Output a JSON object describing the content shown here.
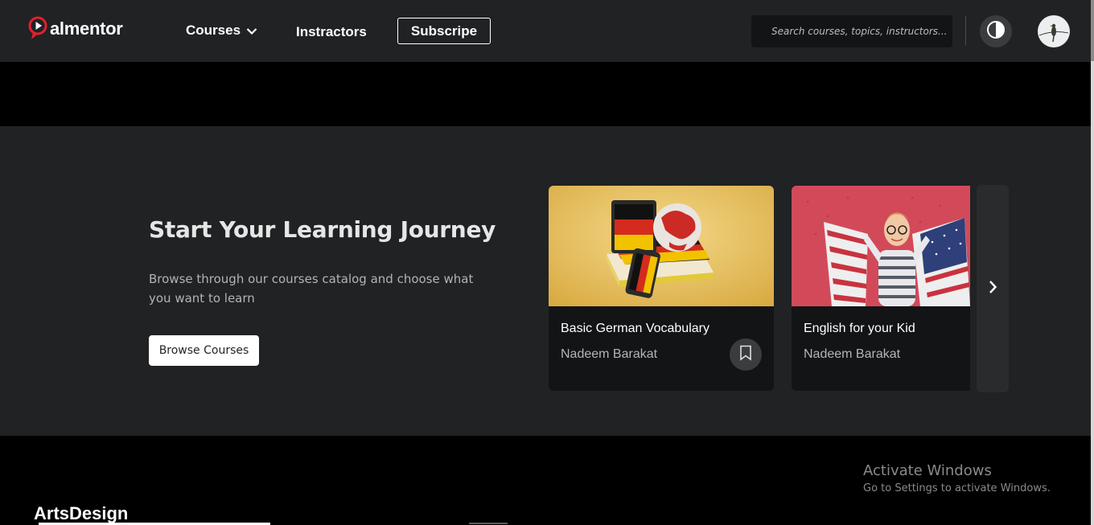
{
  "header": {
    "logo_text": "almentor",
    "nav": {
      "courses_label": "Courses",
      "instructors_label": "Instractors",
      "subscribe_label": "Subscripe"
    },
    "search": {
      "placeholder": "Search courses, topics, instructors..."
    },
    "icons": [
      "play-logo-icon",
      "chevron-down-icon",
      "contrast-icon",
      "avatar-bird-icon"
    ]
  },
  "hero": {
    "title": "Start Your Learning Journey",
    "description": "Browse through our courses catalog and choose what you want to learn",
    "button_label": "Browse Courses",
    "cards": [
      {
        "title": "Basic German Vocabulary",
        "author": "Nadeem Barakat",
        "image": "german-flag-books-globe-image",
        "bookmark_icon": "bookmark-icon"
      },
      {
        "title": "English for your Kid",
        "author": "Nadeem Barakat",
        "image": "boy-with-us-flag-image"
      }
    ],
    "next_icon": "chevron-right-icon"
  },
  "footer": {
    "brand": "ArtsDesign"
  },
  "watermark": {
    "title": "Activate Windows",
    "subtitle": "Go to Settings to activate Windows."
  },
  "colors": {
    "header_bg": "#202224",
    "page_bg": "#000000",
    "hero_bg": "#202224",
    "card_bg": "#131415",
    "logo_red": "#e4202d"
  }
}
